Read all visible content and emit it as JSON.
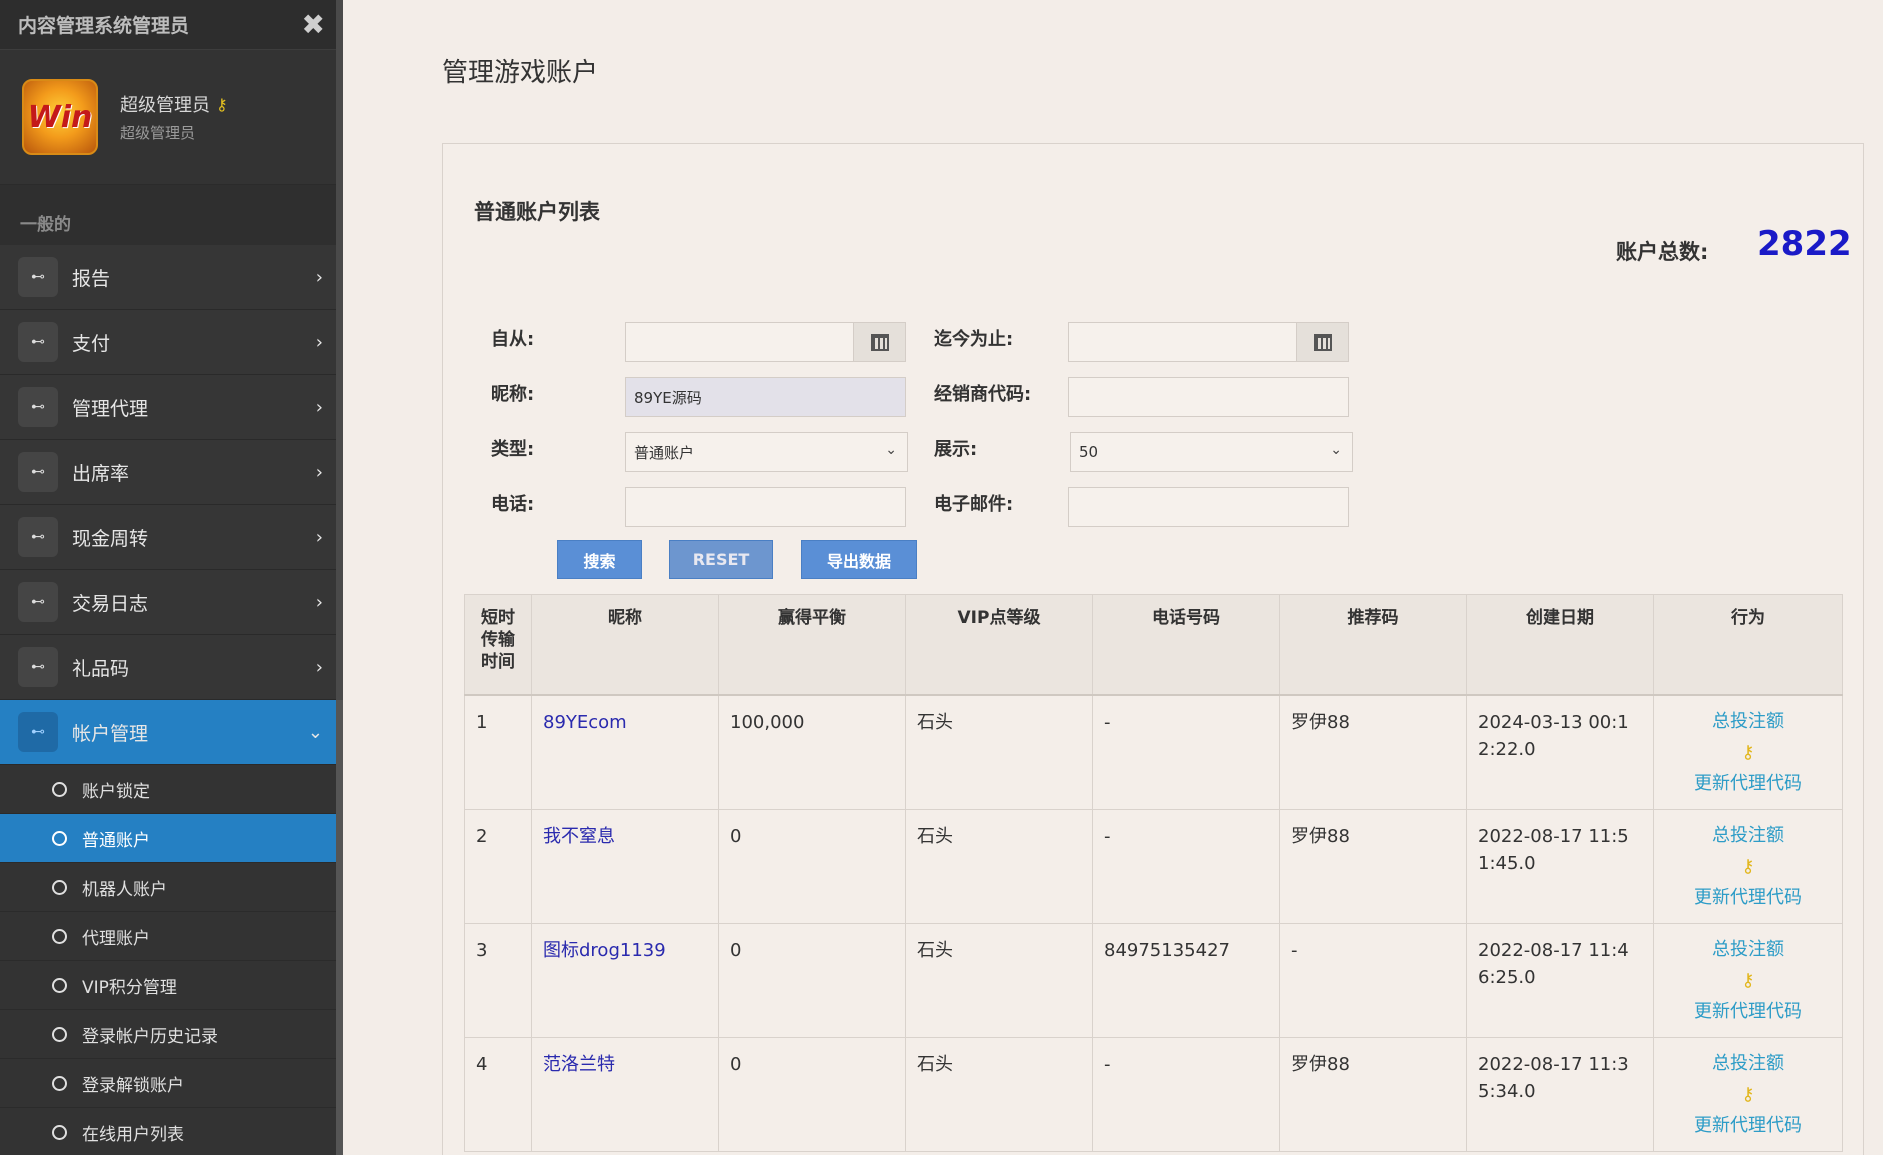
{
  "sidebar": {
    "title": "内容管理系统管理员",
    "close_icon": "✖",
    "profile": {
      "name": "超级管理员",
      "role": "超级管理员",
      "avatar_text": "Win"
    },
    "section_label": "一般的",
    "nav_items": [
      {
        "label": "报告"
      },
      {
        "label": "支付"
      },
      {
        "label": "管理代理"
      },
      {
        "label": "出席率"
      },
      {
        "label": "现金周转"
      },
      {
        "label": "交易日志"
      },
      {
        "label": "礼品码"
      },
      {
        "label": "帐户管理"
      }
    ],
    "sub_items": [
      {
        "label": "账户锁定"
      },
      {
        "label": "普通账户"
      },
      {
        "label": "机器人账户"
      },
      {
        "label": "代理账户"
      },
      {
        "label": "VIP积分管理"
      },
      {
        "label": "登录帐户历史记录"
      },
      {
        "label": "登录解锁账户"
      },
      {
        "label": "在线用户列表"
      }
    ]
  },
  "main": {
    "page_title": "管理游戏账户",
    "panel_title": "普通账户列表",
    "total_label": "账户总数:",
    "total_value": "2822",
    "filters": {
      "from_label": "自从:",
      "from_value": "",
      "to_label": "迄今为止:",
      "to_value": "",
      "nickname_label": "昵称:",
      "nickname_value": "89YE源码",
      "dealer_label": "经销商代码:",
      "dealer_value": "",
      "type_label": "类型:",
      "type_value": "普通账户",
      "show_label": "展示:",
      "show_value": "50",
      "phone_label": "电话:",
      "phone_value": "",
      "email_label": "电子邮件:",
      "email_value": ""
    },
    "buttons": {
      "search": "搜索",
      "reset": "RESET",
      "export": "导出数据"
    },
    "table": {
      "headers": [
        "短时传输时间",
        "昵称",
        "赢得平衡",
        "VIP点等级",
        "电话号码",
        "推荐码",
        "创建日期",
        "行为"
      ],
      "rows": [
        {
          "idx": "1",
          "nickname": "89YEcom",
          "balance": "100,000",
          "vip": "石头",
          "phone": "-",
          "ref": "罗伊88",
          "created": "2024-03-13 00:12:22.0"
        },
        {
          "idx": "2",
          "nickname": "我不窒息",
          "balance": "0",
          "vip": "石头",
          "phone": "-",
          "ref": "罗伊88",
          "created": "2022-08-17 11:51:45.0"
        },
        {
          "idx": "3",
          "nickname": "图标drog1139",
          "balance": "0",
          "vip": "石头",
          "phone": "84975135427",
          "ref": "-",
          "created": "2022-08-17 11:46:25.0"
        },
        {
          "idx": "4",
          "nickname": "范洛兰特",
          "balance": "0",
          "vip": "石头",
          "phone": "-",
          "ref": "罗伊88",
          "created": "2022-08-17 11:35:34.0"
        }
      ],
      "action_total_bet": "总投注额",
      "action_update_code": "更新代理代码"
    }
  }
}
